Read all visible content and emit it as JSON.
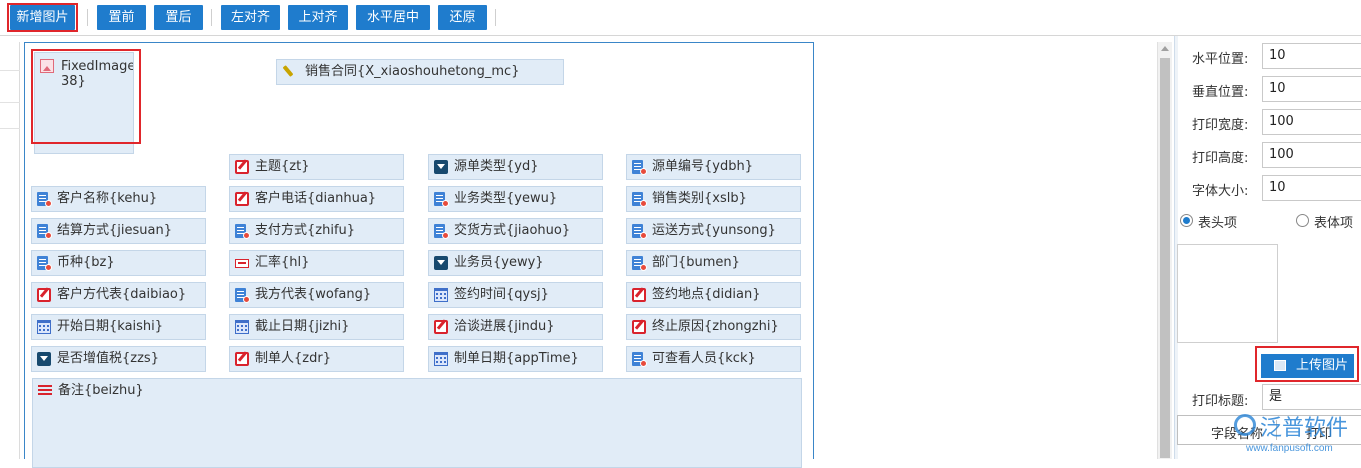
{
  "toolbar": {
    "buttons": [
      "新增图片",
      "置前",
      "置后",
      "左对齐",
      "上对齐",
      "水平居中",
      "还原"
    ]
  },
  "canvas": {
    "fixed_image": {
      "label": "FixedImage{38}",
      "line1": "FixedImage{",
      "line2": "38}"
    },
    "title_field": "销售合同{X_xiaoshouhetong_mc}",
    "fields": [
      {
        "icon": "edit",
        "label": "主题{zt}"
      },
      {
        "icon": "dropdown",
        "label": "源单类型{yd}"
      },
      {
        "icon": "doc",
        "label": "源单编号{ydbh}"
      },
      {
        "icon": "doc",
        "label": "客户名称{kehu}"
      },
      {
        "icon": "edit",
        "label": "客户电话{dianhua}"
      },
      {
        "icon": "doc",
        "label": "业务类型{yewu}"
      },
      {
        "icon": "doc",
        "label": "销售类别{xslb}"
      },
      {
        "icon": "doc",
        "label": "结算方式{jiesuan}"
      },
      {
        "icon": "doc",
        "label": "支付方式{zhifu}"
      },
      {
        "icon": "doc",
        "label": "交货方式{jiaohuo}"
      },
      {
        "icon": "doc",
        "label": "运送方式{yunsong}"
      },
      {
        "icon": "doc",
        "label": "币种{bz}"
      },
      {
        "icon": "number",
        "label": "汇率{hl}"
      },
      {
        "icon": "dropdown",
        "label": "业务员{yewy}"
      },
      {
        "icon": "doc",
        "label": "部门{bumen}"
      },
      {
        "icon": "edit",
        "label": "客户方代表{daibiao}"
      },
      {
        "icon": "doc",
        "label": "我方代表{wofang}"
      },
      {
        "icon": "calendar",
        "label": "签约时间{qysj}"
      },
      {
        "icon": "edit",
        "label": "签约地点{didian}"
      },
      {
        "icon": "calendar",
        "label": "开始日期{kaishi}"
      },
      {
        "icon": "calendar",
        "label": "截止日期{jizhi}"
      },
      {
        "icon": "edit",
        "label": "洽谈进展{jindu}"
      },
      {
        "icon": "edit",
        "label": "终止原因{zhongzhi}"
      },
      {
        "icon": "dropdown",
        "label": "是否增值税{zzs}"
      },
      {
        "icon": "edit",
        "label": "制单人{zdr}"
      },
      {
        "icon": "calendar",
        "label": "制单日期{appTime}"
      },
      {
        "icon": "doc",
        "label": "可查看人员{kck}"
      }
    ],
    "remark_field": "备注{beizhu}"
  },
  "properties": {
    "horizontal_label": "水平位置:",
    "horizontal_value": "10",
    "vertical_label": "垂直位置:",
    "vertical_value": "10",
    "width_label": "打印宽度:",
    "width_value": "100",
    "height_label": "打印高度:",
    "height_value": "100",
    "fontsize_label": "字体大小:",
    "fontsize_value": "10",
    "radio_header": "表头项",
    "radio_body": "表体项",
    "upload_button": "上传图片",
    "print_title_label": "打印标题:",
    "print_title_value": "是",
    "grid_col1": "字段名称",
    "grid_col2": "打印"
  },
  "watermark": {
    "text": "泛普软件",
    "url": "www.fanpusoft.com"
  },
  "colors": {
    "accent": "#1f7ccd",
    "highlight": "#e0262b",
    "field_bg": "#e1ecf7"
  }
}
